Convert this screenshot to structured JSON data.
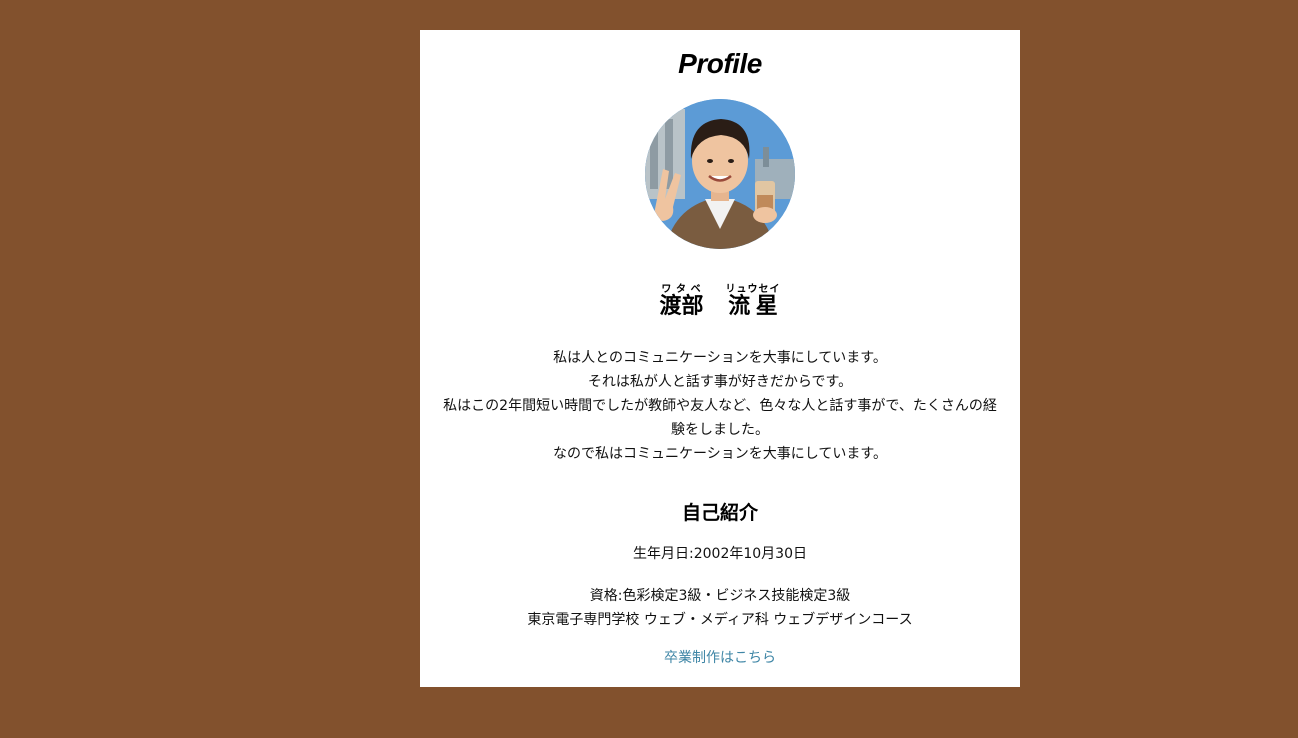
{
  "profile": {
    "heading": "Profile",
    "avatar_alt": "profile photo",
    "name": {
      "family": "渡部",
      "family_ruby": "ワタベ",
      "given": "流星",
      "given_ruby": "リュウセイ"
    },
    "intro_lines": [
      "私は人とのコミュニケーションを大事にしています。",
      "それは私が人と話す事が好きだからです。",
      "私はこの2年間短い時間でしたが教師や友人など、色々な人と話す事がで、たくさんの経験をしました。",
      "なので私はコミュニケーションを大事にしています。"
    ]
  },
  "self_intro": {
    "heading": "自己紹介",
    "birthday": "生年月日:2002年10月30日",
    "qualifications": "資格:色彩検定3級・ビジネス技能検定3級",
    "school": "東京電子専門学校 ウェブ・メディア科 ウェブデザインコース",
    "graduation_link": "卒業制作はこちら"
  },
  "colors": {
    "background": "#82512d",
    "card": "#ffffff",
    "link": "#3f86a6"
  }
}
